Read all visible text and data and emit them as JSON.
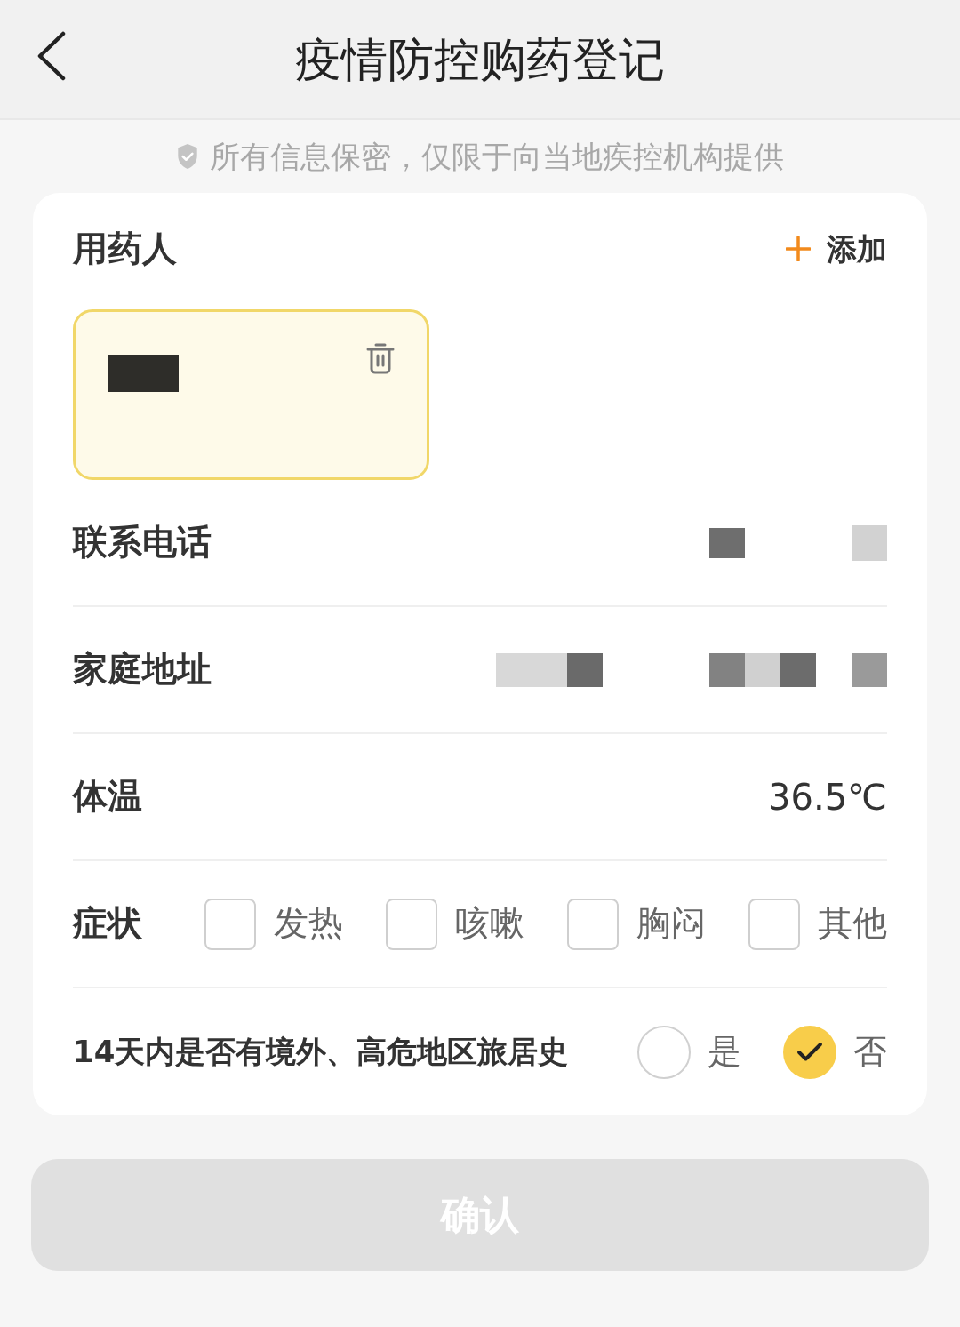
{
  "header": {
    "title": "疫情防控购药登记"
  },
  "notice": "所有信息保密，仅限于向当地疾控机构提供",
  "patient_section": {
    "label": "用药人",
    "add_label": "添加",
    "patients": [
      {
        "selected": true
      }
    ]
  },
  "rows": [
    {
      "kind": "masked",
      "label": "联系电话"
    },
    {
      "kind": "masked",
      "label": "家庭地址"
    },
    {
      "kind": "text",
      "label": "体温",
      "value": "36.5℃"
    },
    {
      "kind": "checkboxes",
      "label": "症状",
      "options": [
        {
          "label": "发热",
          "checked": false
        },
        {
          "label": "咳嗽",
          "checked": false
        },
        {
          "label": "胸闷",
          "checked": false
        },
        {
          "label": "其他",
          "checked": false
        }
      ]
    },
    {
      "kind": "radios",
      "label": "14天内是否有境外、高危地区旅居史",
      "options": [
        {
          "label": "是",
          "selected": false
        },
        {
          "label": "否",
          "selected": true
        }
      ]
    }
  ],
  "confirm_button": {
    "label": "确认",
    "disabled": true
  }
}
